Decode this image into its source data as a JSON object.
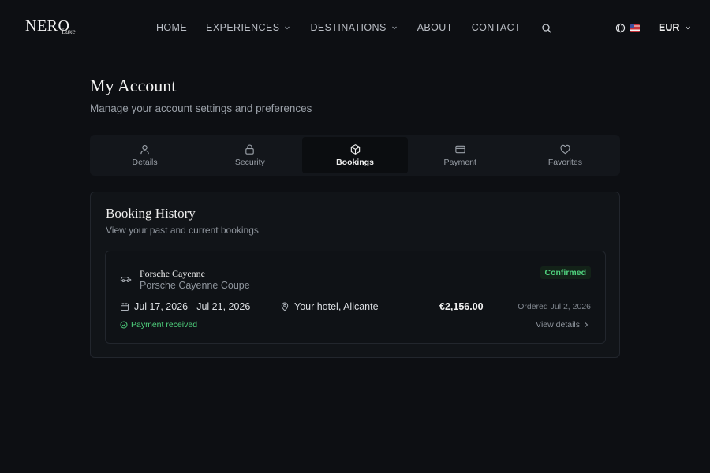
{
  "header": {
    "logo": "NERO",
    "logo_sub": "Luxe",
    "nav": [
      {
        "label": "HOME",
        "has_dropdown": false
      },
      {
        "label": "EXPERIENCES",
        "has_dropdown": true
      },
      {
        "label": "DESTINATIONS",
        "has_dropdown": true
      },
      {
        "label": "ABOUT",
        "has_dropdown": false
      },
      {
        "label": "CONTACT",
        "has_dropdown": false
      }
    ],
    "currency": "EUR"
  },
  "page": {
    "title": "My Account",
    "subtitle": "Manage your account settings and preferences"
  },
  "tabs": [
    {
      "label": "Details",
      "icon": "user-icon",
      "active": false
    },
    {
      "label": "Security",
      "icon": "lock-icon",
      "active": false
    },
    {
      "label": "Bookings",
      "icon": "box-icon",
      "active": true
    },
    {
      "label": "Payment",
      "icon": "credit-card-icon",
      "active": false
    },
    {
      "label": "Favorites",
      "icon": "heart-icon",
      "active": false
    }
  ],
  "booking_history": {
    "title": "Booking History",
    "subtitle": "View your past and current bookings",
    "bookings": [
      {
        "vehicle_name": "Porsche Cayenne",
        "vehicle_model": "Porsche Cayenne Coupe",
        "status": "Confirmed",
        "dates": "Jul 17, 2026 - Jul 21, 2026",
        "location": "Your hotel, Alicante",
        "price": "€2,156.00",
        "ordered": "Ordered Jul 2, 2026",
        "payment_status": "Payment received",
        "view_details": "View details"
      }
    ]
  },
  "colors": {
    "background": "#0d0f13",
    "card": "#111418",
    "success": "#4fd17d",
    "muted_text": "#9aa0a8"
  }
}
